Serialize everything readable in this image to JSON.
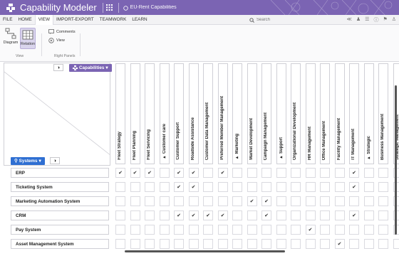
{
  "titlebar": {
    "app_name": "Capability Modeler",
    "document": "EU-Rent Capabilities"
  },
  "menu": {
    "items": [
      {
        "label": "FILE",
        "active": false
      },
      {
        "label": "HOME",
        "active": false
      },
      {
        "label": "VIEW",
        "active": true
      },
      {
        "label": "IMPORT-EXPORT",
        "active": false
      },
      {
        "label": "TEAMWORK",
        "active": false
      },
      {
        "label": "LEARN",
        "active": false
      }
    ],
    "search_placeholder": "Search"
  },
  "ribbon": {
    "diagram_label": "Diagram",
    "relation_label": "Relation",
    "comments_label": "Comments",
    "view_label": "View",
    "group_view": "View",
    "group_right_panels": "Right Panels"
  },
  "matrix": {
    "capabilities_button": "Capabilities",
    "systems_button": "Systems",
    "check_glyph": "✔",
    "columns": [
      {
        "label": "Fleet Strategy",
        "group": false
      },
      {
        "label": "Fleet Planning",
        "group": false
      },
      {
        "label": "Fleet Servicing",
        "group": false
      },
      {
        "label": "Customer care",
        "group": true
      },
      {
        "label": "Customer Support",
        "group": false
      },
      {
        "label": "Roadside Assistance",
        "group": false
      },
      {
        "label": "Customer Data Management",
        "group": false
      },
      {
        "label": "Preferred Member Management",
        "group": false
      },
      {
        "label": "Marketing",
        "group": true
      },
      {
        "label": "Market Development",
        "group": false
      },
      {
        "label": "Campaign Management",
        "group": false
      },
      {
        "label": "Support",
        "group": true
      },
      {
        "label": "Organizational Development",
        "group": false
      },
      {
        "label": "HR Management",
        "group": false
      },
      {
        "label": "Office Management",
        "group": false
      },
      {
        "label": "Facility Management",
        "group": false
      },
      {
        "label": "IT Management",
        "group": false
      },
      {
        "label": "Strategic",
        "group": true
      },
      {
        "label": "Business Management",
        "group": false
      },
      {
        "label": "Strategic Management",
        "group": false
      }
    ],
    "rows": [
      {
        "label": "ERP",
        "checks": [
          0,
          1,
          2,
          4,
          5,
          7,
          16
        ]
      },
      {
        "label": "Ticketing System",
        "checks": [
          4,
          5,
          16
        ]
      },
      {
        "label": "Marketing Automation System",
        "checks": [
          9,
          10
        ]
      },
      {
        "label": "CRM",
        "checks": [
          4,
          5,
          6,
          7,
          10,
          16
        ]
      },
      {
        "label": "Pay System",
        "checks": [
          13
        ]
      },
      {
        "label": "Asset Management System",
        "checks": [
          15
        ]
      }
    ]
  }
}
